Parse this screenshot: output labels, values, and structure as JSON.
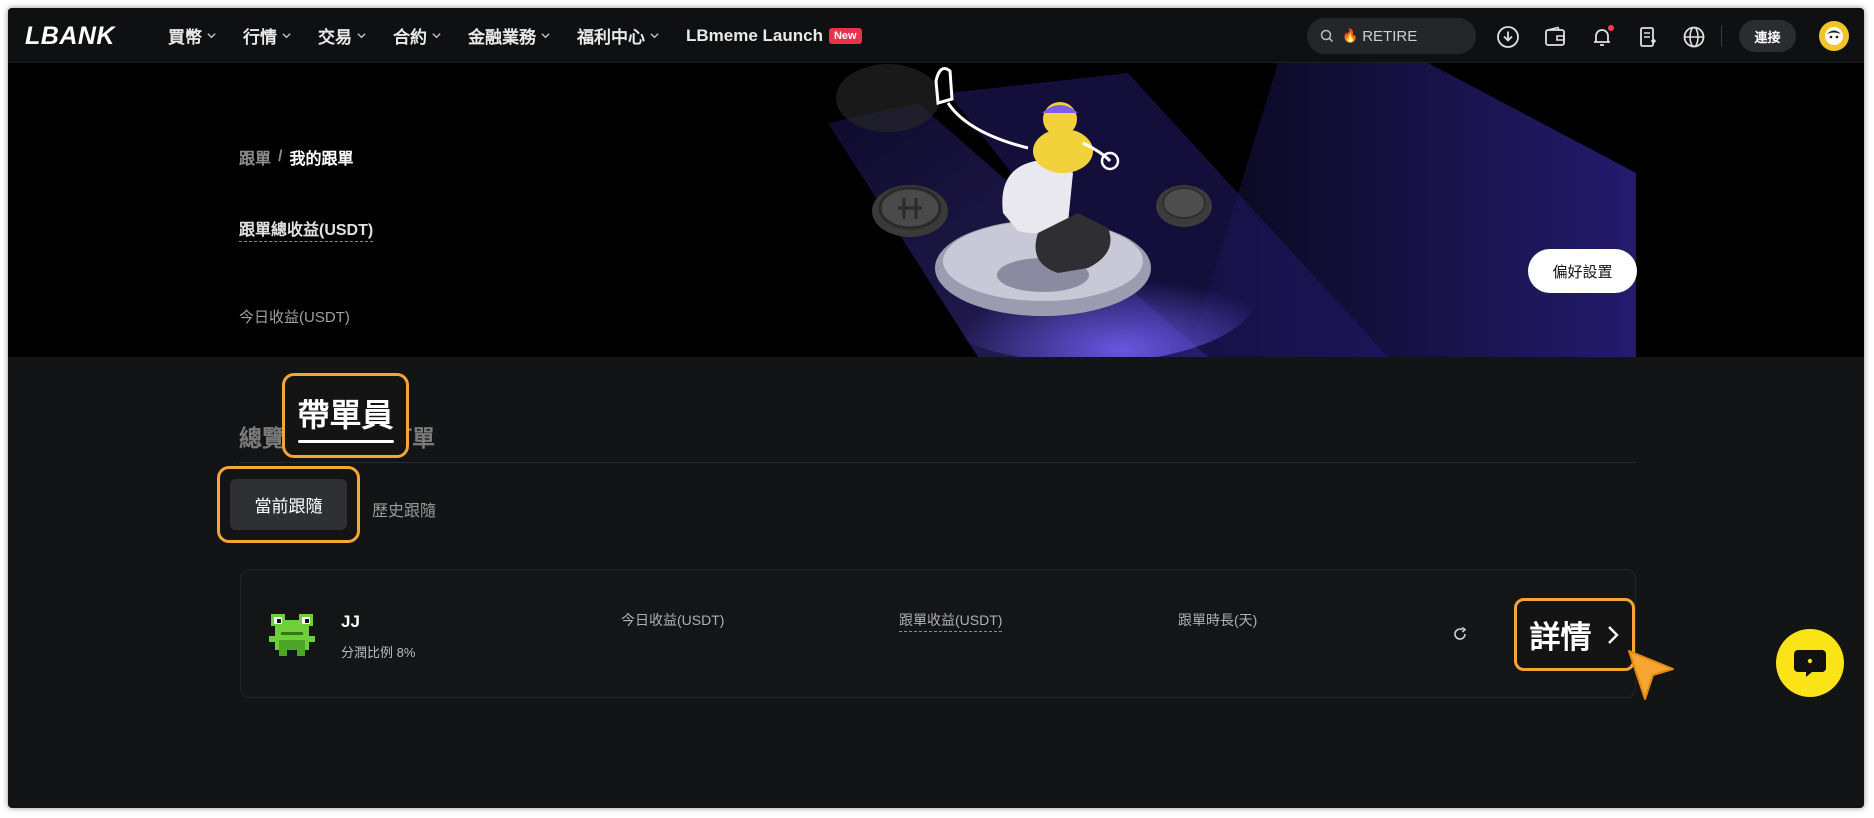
{
  "header": {
    "logo": "LBANK",
    "nav": [
      {
        "label": "買幣",
        "has_dropdown": true
      },
      {
        "label": "行情",
        "has_dropdown": true
      },
      {
        "label": "交易",
        "has_dropdown": true
      },
      {
        "label": "合約",
        "has_dropdown": true
      },
      {
        "label": "金融業務",
        "has_dropdown": true
      },
      {
        "label": "福利中心",
        "has_dropdown": true
      },
      {
        "label": "LBmeme Launch",
        "badge": "New"
      }
    ],
    "search_text": "RETIRE",
    "icons": [
      "download-icon",
      "wallet-icon",
      "bell-icon",
      "document-icon",
      "globe-icon"
    ],
    "connect_label": "連接"
  },
  "banner": {
    "breadcrumb": {
      "parent": "跟單",
      "separator": "/",
      "current": "我的跟單"
    },
    "total_profit_label": "跟單總收益(USDT)",
    "today_profit_label": "今日收益(USDT)",
    "preferences_label": "偏好設置"
  },
  "tabs": {
    "left_partial": "總覽",
    "active": "帶單員",
    "right_partial": "訂單"
  },
  "subtabs": {
    "active": "當前跟隨",
    "other": "歷史跟隨"
  },
  "card": {
    "trader_name": "JJ",
    "profit_share": "分潤比例 8%",
    "col_today": "今日收益(USDT)",
    "col_follow": "跟單收益(USDT)",
    "col_duration": "跟單時長(天)",
    "detail_label": "詳情"
  },
  "colors": {
    "highlight": "#f5a531",
    "chat": "#fae316",
    "badge_new": "#e6334a"
  }
}
